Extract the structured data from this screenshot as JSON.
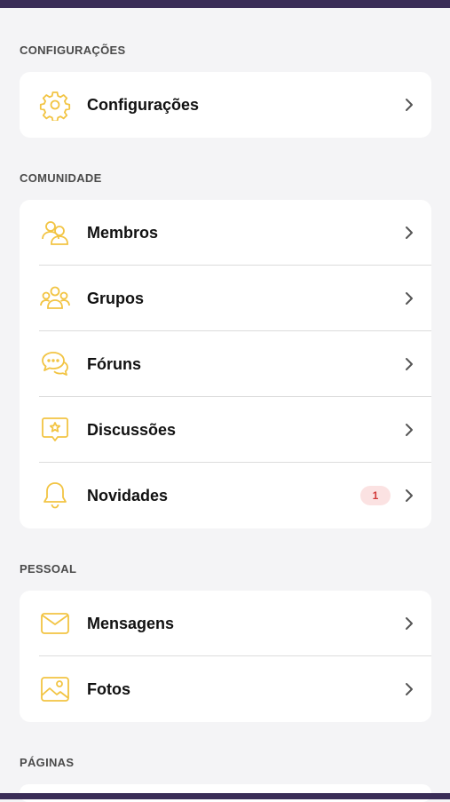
{
  "colors": {
    "accent": "#f2c443",
    "header_bar": "#3a2d57",
    "badge_bg": "#fbe2e2",
    "badge_text": "#d23a3a"
  },
  "sections": {
    "config": {
      "title": "CONFIGURAÇÕES",
      "items": [
        {
          "label": "Configurações",
          "icon": "gear-icon"
        }
      ]
    },
    "community": {
      "title": "COMUNIDADE",
      "items": [
        {
          "label": "Membros",
          "icon": "members-icon"
        },
        {
          "label": "Grupos",
          "icon": "groups-icon"
        },
        {
          "label": "Fóruns",
          "icon": "forums-icon"
        },
        {
          "label": "Discussões",
          "icon": "discussions-icon"
        },
        {
          "label": "Novidades",
          "icon": "bell-icon",
          "badge": "1"
        }
      ]
    },
    "personal": {
      "title": "PESSOAL",
      "items": [
        {
          "label": "Mensagens",
          "icon": "envelope-icon"
        },
        {
          "label": "Fotos",
          "icon": "photo-icon"
        }
      ]
    },
    "pages": {
      "title": "PÁGINAS"
    }
  }
}
